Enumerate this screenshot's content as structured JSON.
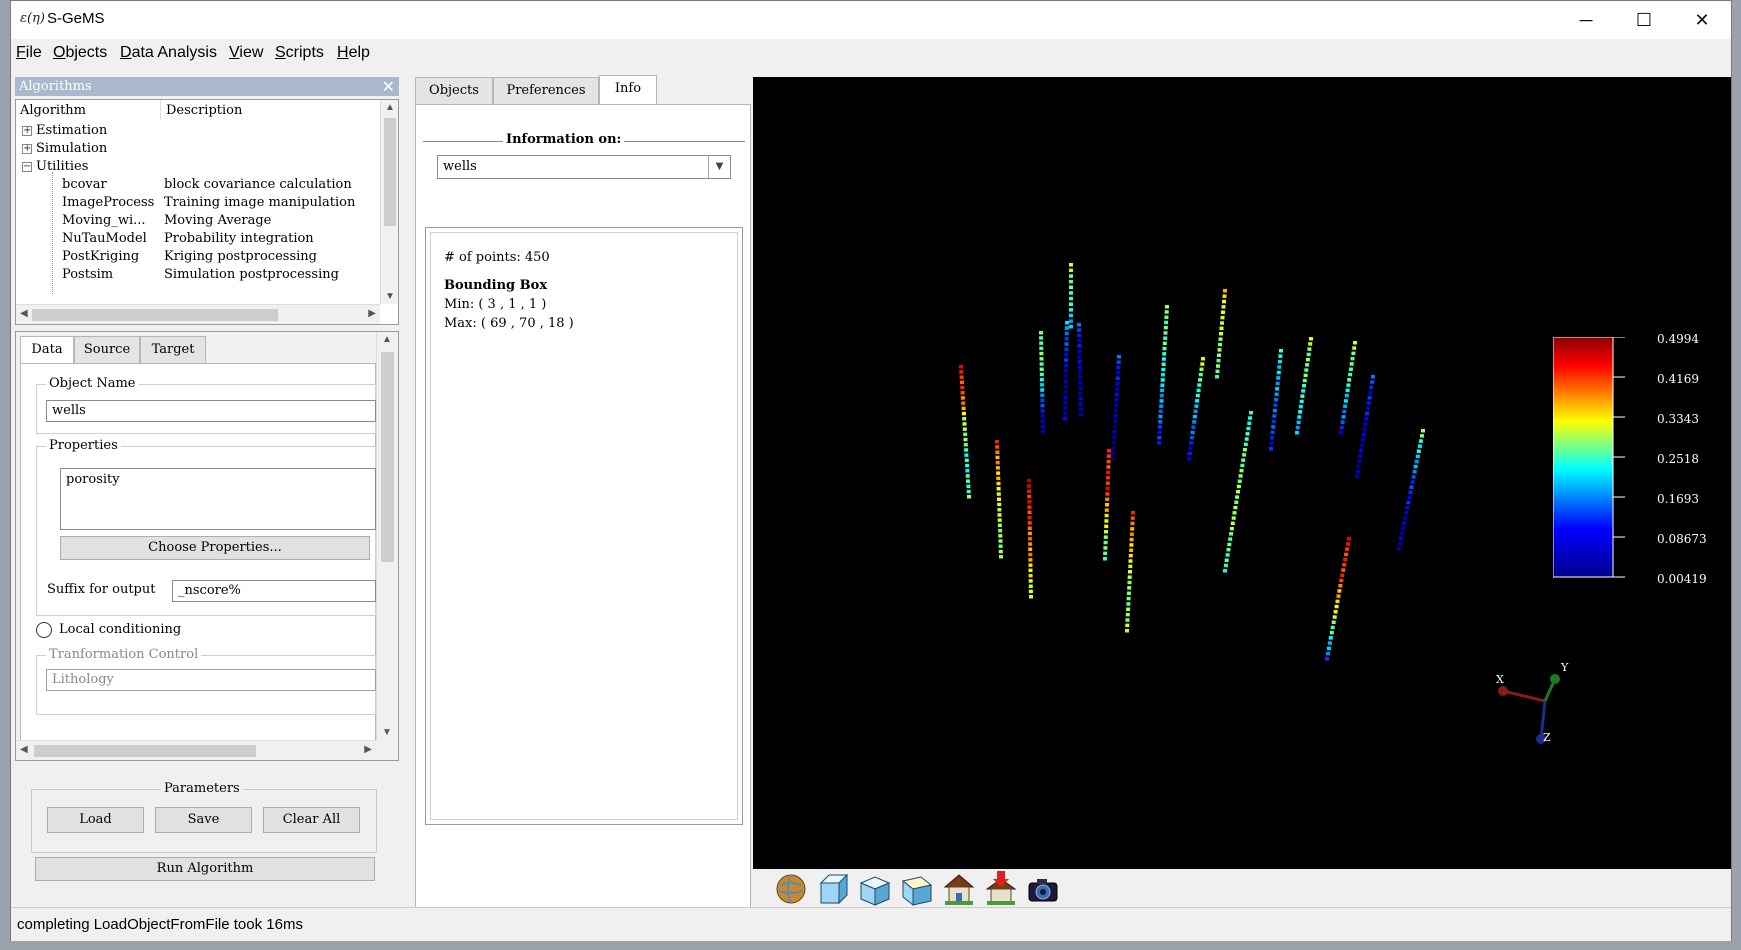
{
  "app": {
    "title": "S-GeMS",
    "icon_glyph": "ε(η)"
  },
  "window_controls": {
    "minimize": "─",
    "maximize": "☐",
    "close": "✕"
  },
  "menu": [
    {
      "label": "File",
      "u": "F",
      "rest": "ile"
    },
    {
      "label": "Objects",
      "u": "O",
      "rest": "bjects"
    },
    {
      "label": "Data Analysis",
      "u": "D",
      "rest": "ata Analysis"
    },
    {
      "label": "View",
      "u": "V",
      "rest": "iew"
    },
    {
      "label": "Scripts",
      "u": "S",
      "rest": "cripts"
    },
    {
      "label": "Help",
      "u": "H",
      "rest": "elp"
    }
  ],
  "algorithms_panel": {
    "title": "Algorithms",
    "columns": [
      "Algorithm",
      "Description"
    ],
    "groups": [
      {
        "label": "Estimation",
        "expander": "+"
      },
      {
        "label": "Simulation",
        "expander": "+"
      },
      {
        "label": "Utilities",
        "expander": "−"
      }
    ],
    "items": [
      {
        "name": "bcovar",
        "desc": "block covariance calculation"
      },
      {
        "name": "ImageProcess",
        "desc": "Training image manipulation"
      },
      {
        "name": "Moving_wi...",
        "desc": "Moving Average"
      },
      {
        "name": "NuTauModel",
        "desc": "Probability integration"
      },
      {
        "name": "PostKriging",
        "desc": "Kriging postprocessing"
      },
      {
        "name": "Postsim",
        "desc": "Simulation postprocessing"
      }
    ]
  },
  "params_tabs": {
    "tabs": [
      "Data",
      "Source",
      "Target"
    ],
    "object_name_label": "Object Name",
    "object_name_value": "wells",
    "properties_label": "Properties",
    "properties_list": [
      "porosity"
    ],
    "choose_properties": "Choose Properties...",
    "suffix_label": "Suffix for output",
    "suffix_value": "_nscore%",
    "local_conditioning": "Local conditioning",
    "transformation_label": "Tranformation Control",
    "lithology_placeholder": "Lithology"
  },
  "parameters": {
    "label": "Parameters",
    "load": "Load",
    "save": "Save",
    "clear": "Clear All",
    "run": "Run Algorithm"
  },
  "middle_tabs": [
    "Objects",
    "Preferences",
    "Info"
  ],
  "info": {
    "info_on_label": "Information on:",
    "selected": "wells",
    "points_line": "# of points: 450",
    "bbox_title": "Bounding Box",
    "min_line": "Min: ( 3 , 1 , 1 )",
    "max_line": "Max: ( 69 , 70 , 18 )"
  },
  "colorbar": {
    "labels": [
      "0.4994",
      "0.4169",
      "0.3343",
      "0.2518",
      "0.1693",
      "0.08673",
      "0.00419"
    ]
  },
  "axes": {
    "x": "X",
    "y": "Y",
    "z": "Z"
  },
  "toolbar_icons": [
    "globe-icon",
    "cube-front-icon",
    "cube-side-icon",
    "cube-top-icon",
    "house-icon",
    "house-arrow-icon",
    "camera-icon"
  ],
  "status": {
    "message": "completing LoadObjectFromFile took 16ms"
  }
}
